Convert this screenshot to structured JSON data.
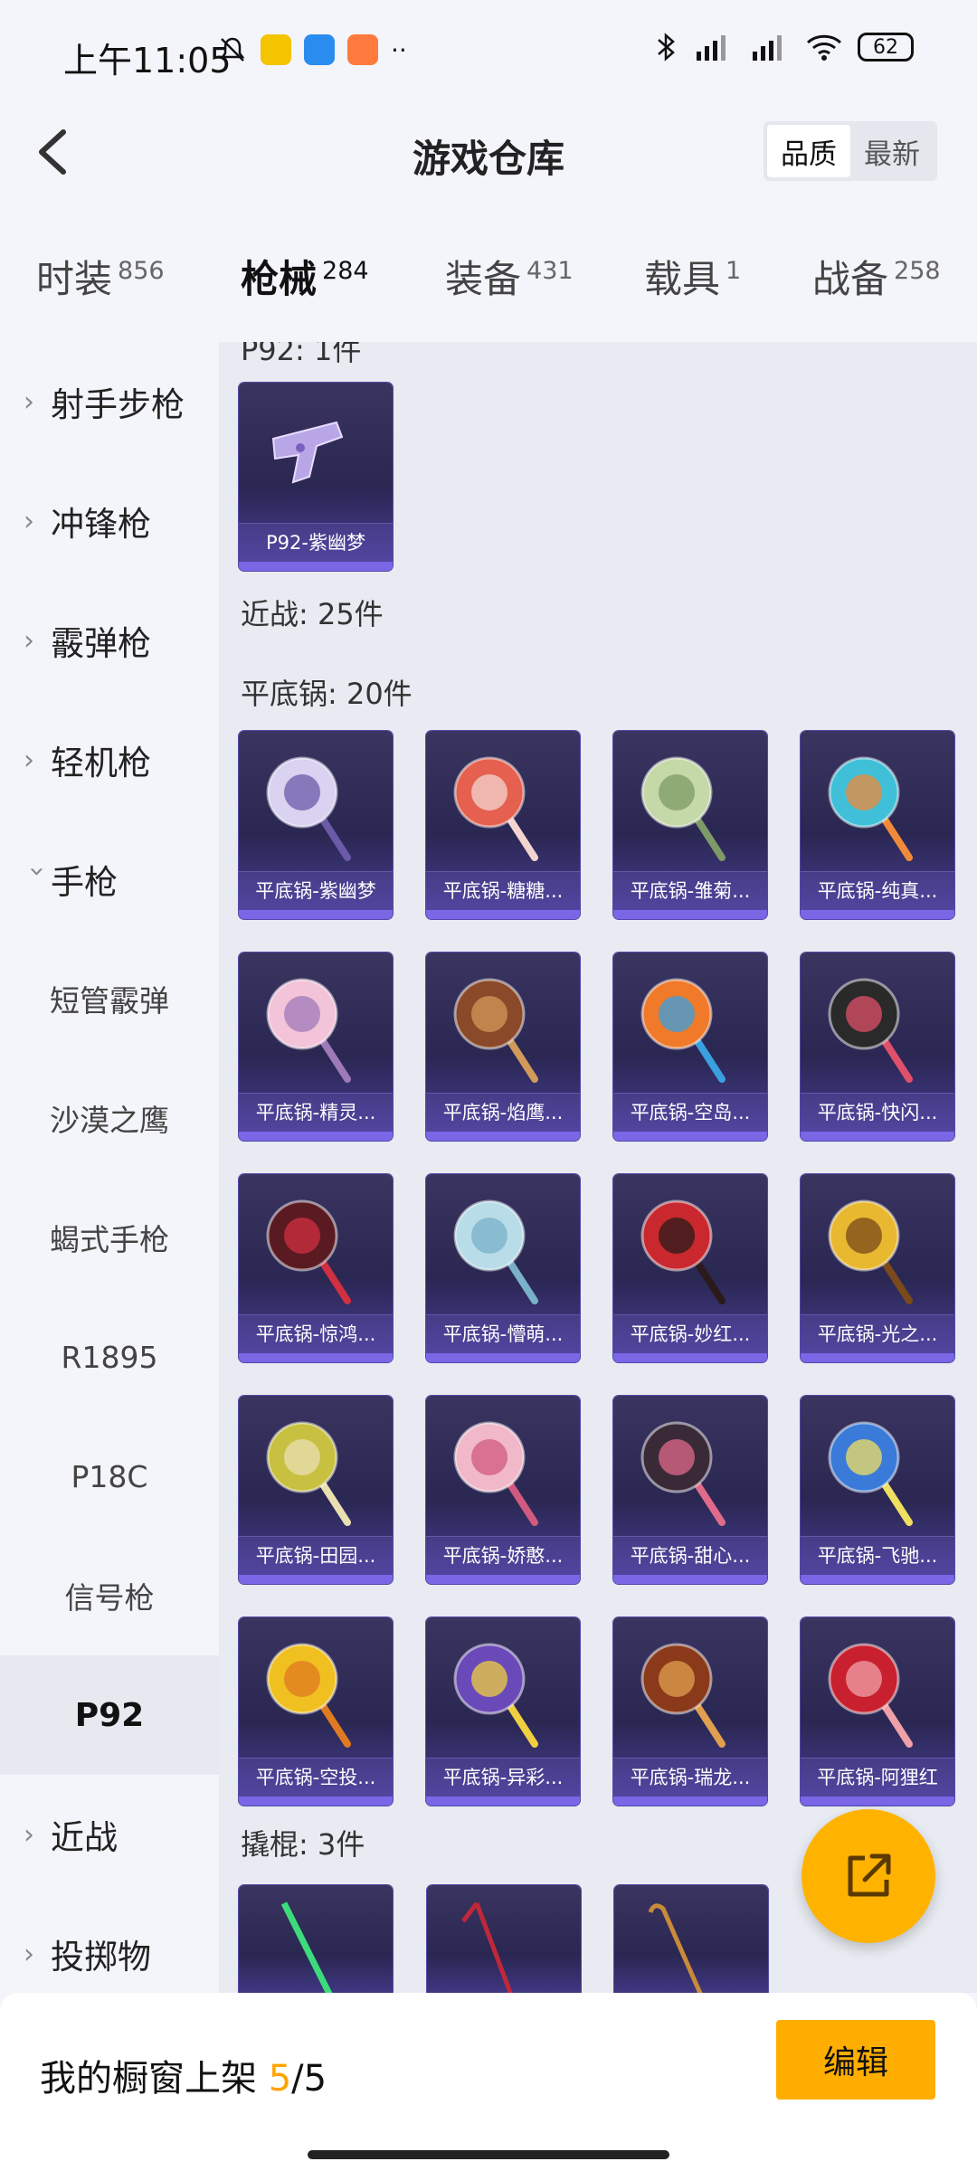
{
  "status": {
    "time": "上午11:05",
    "battery": "62"
  },
  "header": {
    "title": "游戏仓库",
    "sort_quality": "品质",
    "sort_latest": "最新"
  },
  "tabs": [
    {
      "label": "时装",
      "count": "856"
    },
    {
      "label": "枪械",
      "count": "284"
    },
    {
      "label": "装备",
      "count": "431"
    },
    {
      "label": "载具",
      "count": "1"
    },
    {
      "label": "战备",
      "count": "258"
    }
  ],
  "sidebar": {
    "items": [
      {
        "label": "射手步枪"
      },
      {
        "label": "冲锋枪"
      },
      {
        "label": "霰弹枪"
      },
      {
        "label": "轻机枪"
      },
      {
        "label": "手枪"
      },
      {
        "label": "短管霰弹"
      },
      {
        "label": "沙漠之鹰"
      },
      {
        "label": "蝎式手枪"
      },
      {
        "label": "R1895"
      },
      {
        "label": "P18C"
      },
      {
        "label": "信号枪"
      },
      {
        "label": "P92"
      },
      {
        "label": "近战"
      },
      {
        "label": "投掷物"
      }
    ]
  },
  "content": {
    "p92_header": "P92: 1件",
    "p92_item": "P92-紫幽梦",
    "melee_header": "近战: 25件",
    "pan_header": "平底锅: 20件",
    "pans": [
      "平底锅-紫幽梦",
      "平底锅-糖糖...",
      "平底锅-雏菊...",
      "平底锅-纯真...",
      "平底锅-精灵...",
      "平底锅-焰鹰...",
      "平底锅-空岛...",
      "平底锅-快闪...",
      "平底锅-惊鸿...",
      "平底锅-懵萌...",
      "平底锅-妙红...",
      "平底锅-光之...",
      "平底锅-田园...",
      "平底锅-娇憨...",
      "平底锅-甜心...",
      "平底锅-飞驰...",
      "平底锅-空投...",
      "平底锅-异彩...",
      "平底锅-瑞龙...",
      "平底锅-阿狸红"
    ],
    "crowbar_header": "撬棍: 3件"
  },
  "bottom": {
    "label": "我的橱窗上架",
    "current": "5",
    "total": "/5",
    "edit": "编辑"
  },
  "colors": {
    "accent": "#ffae00",
    "card_bg": "#2a2752",
    "card_border": "#7b66e6"
  }
}
